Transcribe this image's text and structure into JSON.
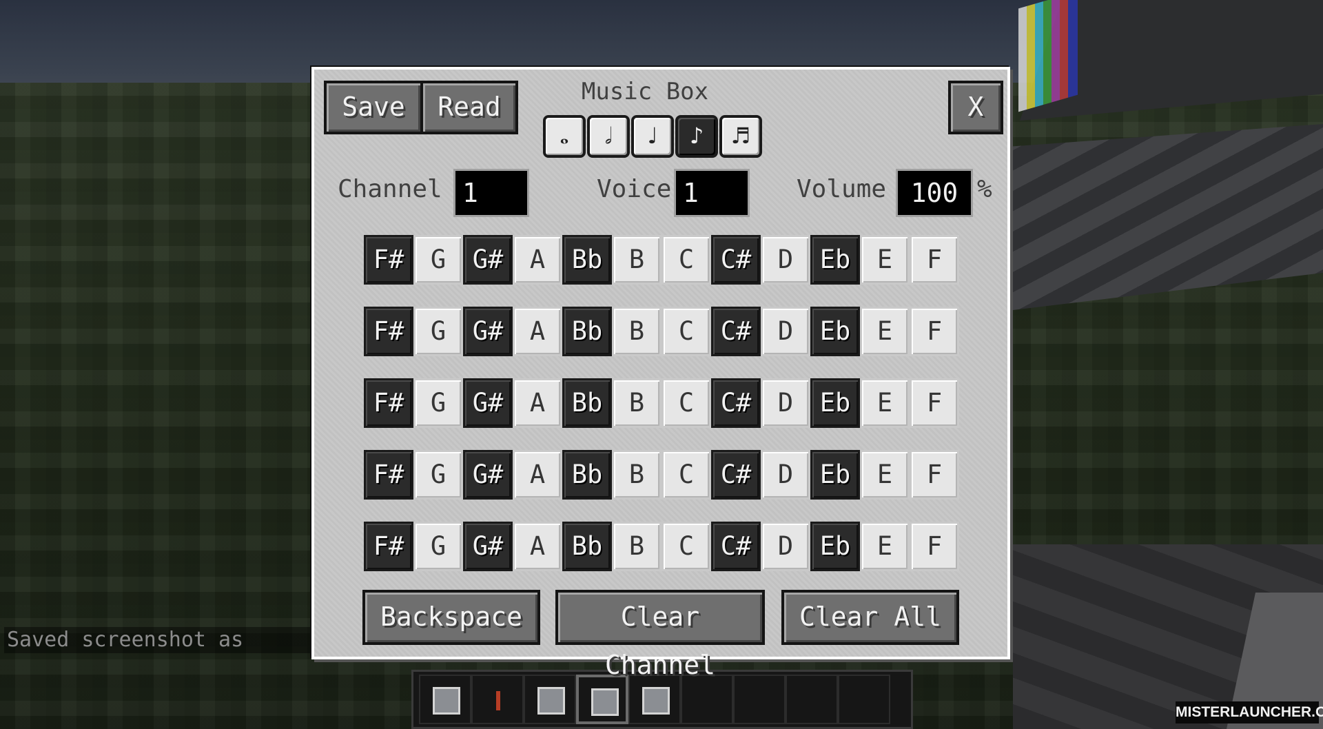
{
  "dialog": {
    "title": "Music Box",
    "save_label": "Save",
    "read_label": "Read",
    "close_label": "X",
    "note_lengths": [
      {
        "icon": "whole-note-icon",
        "glyph": "𝅝",
        "selected": false
      },
      {
        "icon": "half-note-icon",
        "glyph": "𝅗𝅥",
        "selected": false
      },
      {
        "icon": "quarter-note-icon",
        "glyph": "♩",
        "selected": false
      },
      {
        "icon": "eighth-note-icon",
        "glyph": "♪",
        "selected": true
      },
      {
        "icon": "sixteenth-note-icon",
        "glyph": "♬",
        "selected": false
      }
    ],
    "channel": {
      "label": "Channel",
      "value": "1"
    },
    "voice": {
      "label": "Voice",
      "value": "1"
    },
    "volume": {
      "label": "Volume",
      "value": "100",
      "unit": "%"
    },
    "keys": [
      "F#",
      "G",
      "G#",
      "A",
      "Bb",
      "B",
      "C",
      "C#",
      "D",
      "Eb",
      "E",
      "F"
    ],
    "black_keys": [
      "F#",
      "G#",
      "Bb",
      "C#",
      "Eb"
    ],
    "rows": 5,
    "backspace_label": "Backspace",
    "clear_channel_label": "Clear Channel",
    "clear_all_label": "Clear All"
  },
  "chat": {
    "message": "Saved screenshot as"
  },
  "watermark": "MISTERLAUNCHER.ORG",
  "hotbar": {
    "selected_slot": 4,
    "slots": 9
  },
  "colors": {
    "panel": "#c6c6c6",
    "button": "#6f6f6f",
    "black_key": "#2b2b2b",
    "white_key": "#e6e6e6"
  }
}
